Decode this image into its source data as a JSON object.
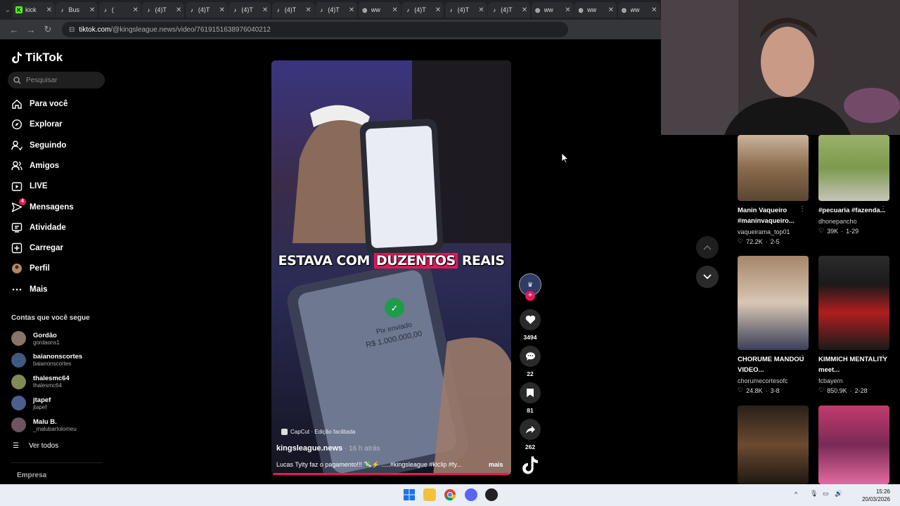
{
  "tabs": [
    {
      "label": "kick",
      "icon": "kick-icon",
      "color": "#53fc18"
    },
    {
      "label": "Bus",
      "icon": "tiktok-icon",
      "color": "#ffffff"
    },
    {
      "label": "(",
      "icon": "tiktok-icon",
      "color": "#ffffff"
    },
    {
      "label": "(4)T",
      "icon": "tiktok-icon",
      "color": "#ffffff"
    },
    {
      "label": "(4)T",
      "icon": "tiktok-icon",
      "color": "#ffffff"
    },
    {
      "label": "(4)T",
      "icon": "tiktok-icon",
      "color": "#ffffff"
    },
    {
      "label": "(4)T",
      "icon": "tiktok-icon",
      "color": "#ffffff"
    },
    {
      "label": "(4)T",
      "icon": "tiktok-icon",
      "color": "#ffffff"
    },
    {
      "label": "ww",
      "icon": "globe-icon",
      "color": "#cccccc"
    },
    {
      "label": "(4)T",
      "icon": "tiktok-icon",
      "color": "#ffffff"
    },
    {
      "label": "(4)T",
      "icon": "tiktok-icon",
      "color": "#ffffff"
    },
    {
      "label": "(4)T",
      "icon": "tiktok-icon",
      "color": "#ffffff"
    },
    {
      "label": "ww",
      "icon": "globe-icon",
      "color": "#cccccc"
    },
    {
      "label": "ww",
      "icon": "globe-icon",
      "color": "#cccccc"
    },
    {
      "label": "ww",
      "icon": "globe-icon",
      "color": "#cccccc"
    }
  ],
  "address": {
    "host": "tiktok.com",
    "path": "/@kingsleague.news/video/7619151638976040212"
  },
  "sidebar": {
    "brand": "TikTok",
    "search_placeholder": "Pesquisar",
    "nav": [
      {
        "label": "Para você",
        "icon": "home-icon"
      },
      {
        "label": "Explorar",
        "icon": "compass-icon"
      },
      {
        "label": "Seguindo",
        "icon": "following-icon"
      },
      {
        "label": "Amigos",
        "icon": "friends-icon"
      },
      {
        "label": "LIVE",
        "icon": "live-icon"
      },
      {
        "label": "Mensagens",
        "icon": "messages-icon",
        "badge": "4"
      },
      {
        "label": "Atividade",
        "icon": "activity-icon"
      },
      {
        "label": "Carregar",
        "icon": "upload-icon"
      },
      {
        "label": "Perfil",
        "icon": "profile-avatar-icon"
      },
      {
        "label": "Mais",
        "icon": "more-icon"
      }
    ],
    "following_title": "Contas que você segue",
    "following": [
      {
        "name": "Gordão",
        "handle": "gordaons1"
      },
      {
        "name": "baianonscortes",
        "handle": "baianonscortes"
      },
      {
        "name": "thalesmc64",
        "handle": "thalesmc64"
      },
      {
        "name": "jtapef",
        "handle": "jtapef"
      },
      {
        "name": "Malu B.",
        "handle": "_malubartolomeu"
      }
    ],
    "see_all": "Ver todos",
    "company": "Empresa"
  },
  "video": {
    "caption_pre": "ESTAVA COM",
    "caption_hl": "DUZENTOS",
    "caption_post": "REAIS",
    "capcut": "CapCut · Edição facilitada",
    "author": "kingsleague.news",
    "time_ago": " · 16 h atrás",
    "description": "Lucas Tylty faz o pagamento!!! 💸⚡ .....#kingsleague #klclip #fy...",
    "more": "mais",
    "phone_text": "Pix enviado",
    "phone_amount": "R$ 1.000.000,00",
    "progress": 1.0
  },
  "actions": {
    "likes": "3494",
    "comments": "22",
    "saves": "81",
    "shares": "262"
  },
  "recommended": [
    {
      "title": "Manin Vaqueiro #maninvaqueiro...",
      "author": "vaqueirama_top01",
      "likes": "72.2K",
      "date": "2-5"
    },
    {
      "title": "#pecuaria #fazenda...",
      "author": "dhonepancho",
      "likes": "39K",
      "date": "1-29"
    },
    {
      "title": "CHORUME MANDOU VIDEO...",
      "author": "chorumecortesofc",
      "likes": "24.8K",
      "date": "3-8"
    },
    {
      "title": "KIMMICH MENTALITY meet...",
      "author": "fcbayern",
      "likes": "850.9K",
      "date": "2-28"
    },
    {
      "title": "",
      "author": "",
      "likes": "",
      "date": ""
    },
    {
      "title": "",
      "author": "",
      "likes": "",
      "date": ""
    }
  ],
  "clock": {
    "time": "15:26",
    "date": "20/03/2026"
  },
  "colors": {
    "accent": "#e5185a",
    "bg": "#000000",
    "chrome": "#202124"
  }
}
